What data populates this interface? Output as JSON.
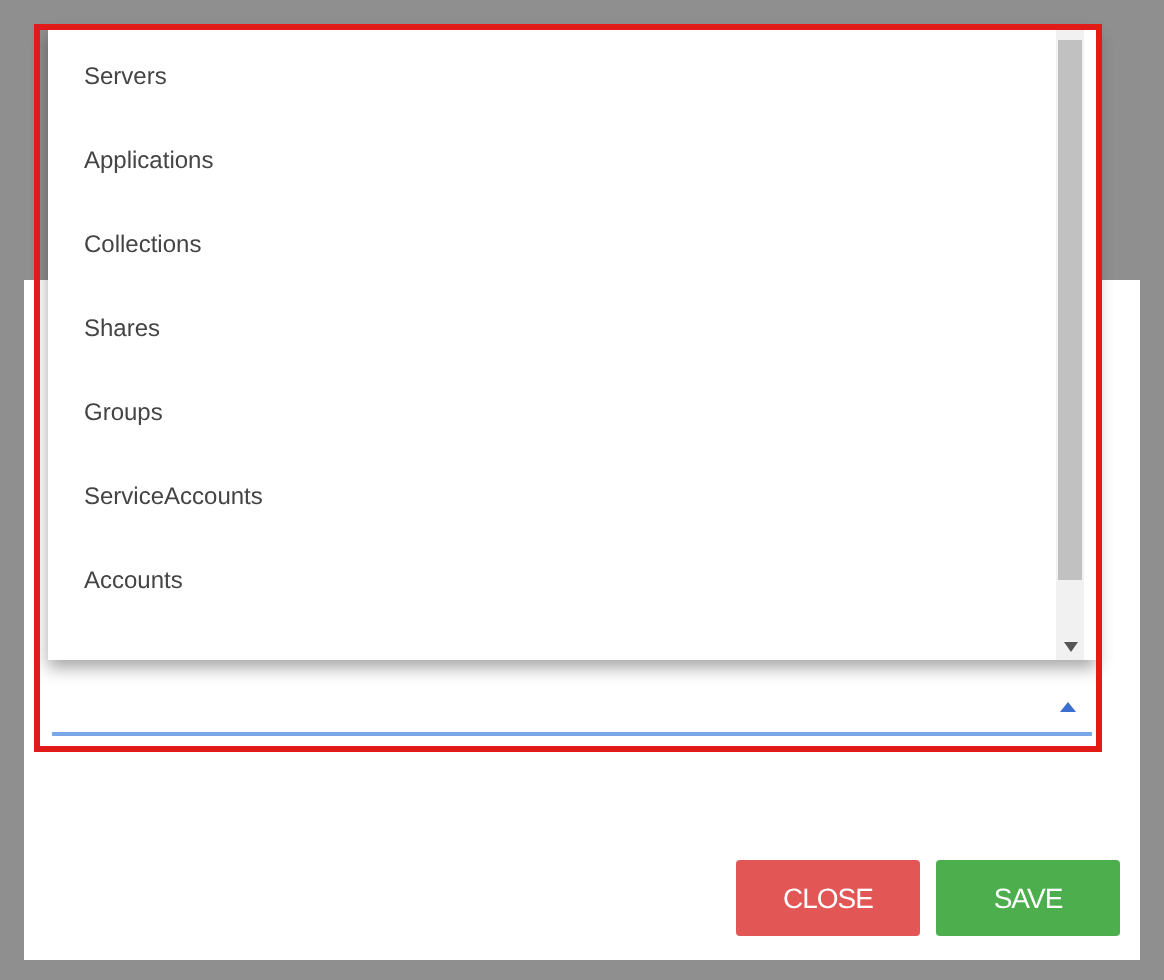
{
  "select": {
    "expanded": true,
    "options": [
      {
        "label": "Servers"
      },
      {
        "label": "Applications"
      },
      {
        "label": "Collections"
      },
      {
        "label": "Shares"
      },
      {
        "label": "Groups"
      },
      {
        "label": "ServiceAccounts"
      },
      {
        "label": "Accounts"
      }
    ]
  },
  "buttons": [
    {
      "label": "CLOSE",
      "kind": "close"
    },
    {
      "label": "SAVE",
      "kind": "save"
    }
  ]
}
